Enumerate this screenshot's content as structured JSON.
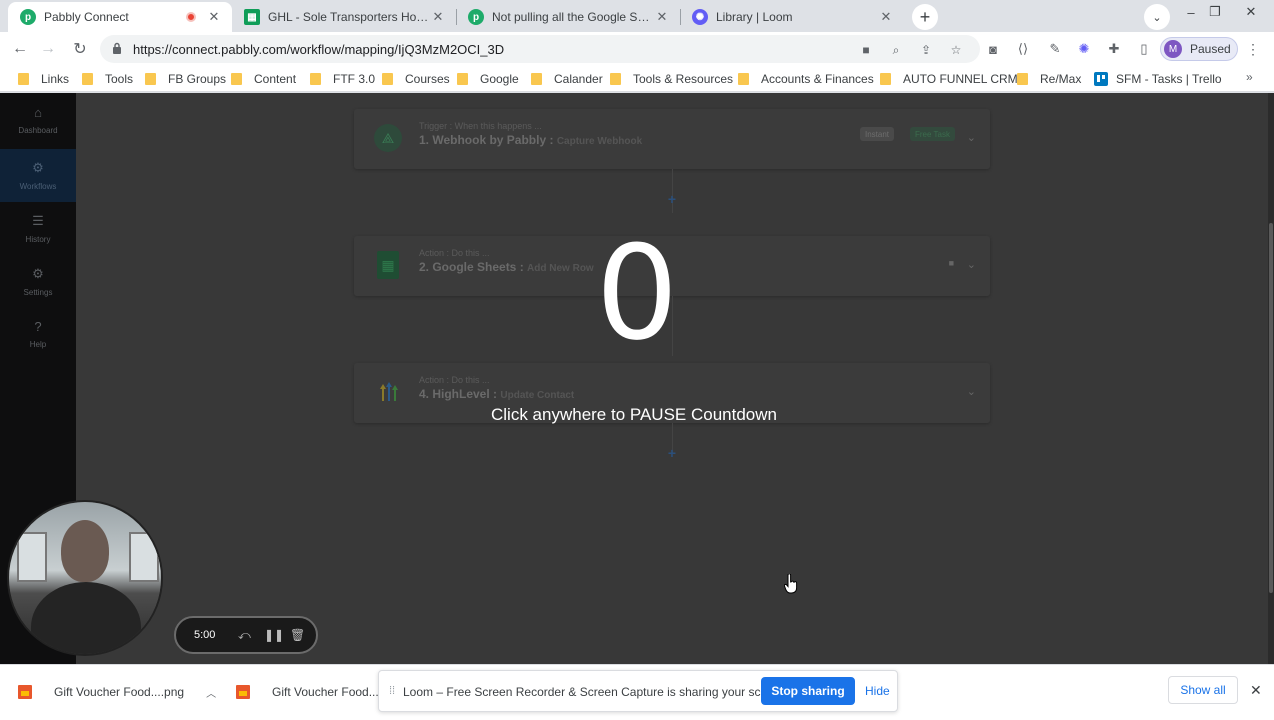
{
  "tabs": [
    {
      "title": "Pabbly Connect",
      "favicon": "pabbly-icon",
      "active": true,
      "recording": true
    },
    {
      "title": "GHL - Sole Transporters Homes C",
      "favicon": "google-sheets-icon"
    },
    {
      "title": "Not pulling all the Google Sheets",
      "favicon": "pabbly-icon"
    },
    {
      "title": "Library | Loom",
      "favicon": "loom-icon"
    }
  ],
  "toolbar": {
    "url": "https://connect.pabbly.com/workflow/mapping/IjQ3MzM2OCI_3D",
    "profile_initial": "M",
    "profile_label": "Paused"
  },
  "bookmarks": [
    {
      "label": "Links",
      "type": "folder"
    },
    {
      "label": "Tools",
      "type": "folder"
    },
    {
      "label": "FB Groups",
      "type": "folder"
    },
    {
      "label": "Content",
      "type": "folder"
    },
    {
      "label": "FTF 3.0",
      "type": "folder"
    },
    {
      "label": "Courses",
      "type": "folder"
    },
    {
      "label": "Google",
      "type": "folder"
    },
    {
      "label": "Calander",
      "type": "folder"
    },
    {
      "label": "Tools & Resources",
      "type": "folder"
    },
    {
      "label": "Accounts & Finances",
      "type": "folder"
    },
    {
      "label": "AUTO FUNNEL CRM",
      "type": "folder"
    },
    {
      "label": "Re/Max",
      "type": "folder"
    },
    {
      "label": "SFM - Tasks | Trello",
      "type": "trello"
    }
  ],
  "sidebar": [
    {
      "label": "Dashboard",
      "icon": "home-icon"
    },
    {
      "label": "Workflows",
      "icon": "workflow-icon",
      "active": true
    },
    {
      "label": "History",
      "icon": "list-icon"
    },
    {
      "label": "Settings",
      "icon": "gear-icon"
    },
    {
      "label": "Help",
      "icon": "help-icon"
    }
  ],
  "workflow": {
    "steps": [
      {
        "sub": "Trigger : When this happens ...",
        "title": "1. Webhook by Pabbly :",
        "event": "Capture Webhook",
        "badges": [
          "Instant",
          "Free Task"
        ],
        "icon": "webhook-icon"
      },
      {
        "sub": "Action : Do this ...",
        "title": "2. Google Sheets :",
        "event": "Add New Row",
        "icon": "google-sheets-icon"
      },
      {
        "sub": "Action : Do this ...",
        "title": "4. HighLevel :",
        "event": "Update Contact",
        "icon": "highlevel-icon"
      }
    ]
  },
  "countdown": {
    "value": "0",
    "message": "Click anywhere to PAUSE Countdown"
  },
  "loom": {
    "timer": "5:00"
  },
  "downloads": [
    {
      "name": "Gift Voucher Food....png"
    },
    {
      "name": "Gift Voucher Food....p"
    }
  ],
  "sharing": {
    "message": "Loom – Free Screen Recorder & Screen Capture is sharing your screen.",
    "stop_label": "Stop sharing",
    "hide_label": "Hide"
  },
  "show_all_label": "Show all",
  "colors": {
    "accent": "#1a73e8",
    "pabbly_green": "#1eab6a",
    "sidebar_bg": "#0e0e0f",
    "overlay_bg": "#383838"
  }
}
